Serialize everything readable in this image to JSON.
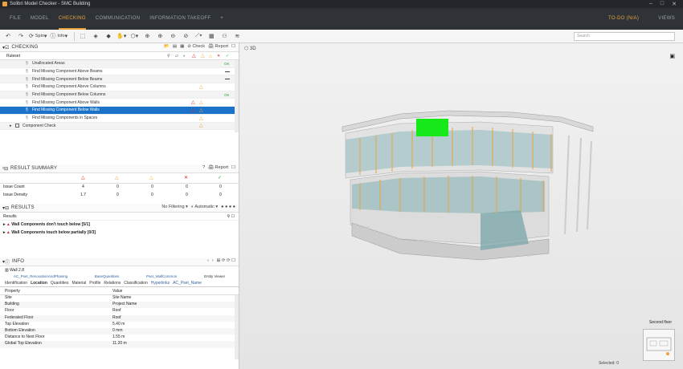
{
  "window": {
    "title": "Solibri Model Checker - SMC Building"
  },
  "menu": {
    "items": [
      "FILE",
      "MODEL",
      "CHECKING",
      "COMMUNICATION",
      "INFORMATION TAKEOFF",
      "+"
    ],
    "active_index": 2,
    "todo": "TO-DO (N/A)",
    "views": "VIEWS"
  },
  "toolbar": {
    "spin": "Spin",
    "info": "Info",
    "search_placeholder": "Search"
  },
  "checking": {
    "title": "CHECKING",
    "check": "Check",
    "report": "Report",
    "ruleset_header": "Ruleset",
    "rows": [
      {
        "label": "Unallocated Areas",
        "status": "OK"
      },
      {
        "label": "Find Missing Component Above Beams",
        "status": "dash"
      },
      {
        "label": "Find Missing Component Below Beams",
        "status": "dash"
      },
      {
        "label": "Find Missing Component Above Columns",
        "status": "warn"
      },
      {
        "label": "Find Missing Component Below Columns",
        "status": "OK"
      },
      {
        "label": "Find Missing Component Above Walls",
        "status": "err-warn"
      },
      {
        "label": "Find Missing Component Below Walls",
        "status": "err-warn",
        "selected": true
      },
      {
        "label": "Find Missing Components in Spaces",
        "status": "warn"
      },
      {
        "label": "Component Check",
        "status": "warn"
      }
    ]
  },
  "summary": {
    "title": "RESULT SUMMARY",
    "report": "Report",
    "rows": [
      {
        "label": "Issue Count",
        "values": [
          "4",
          "0",
          "0",
          "0",
          "0"
        ]
      },
      {
        "label": "Issue Density",
        "values": [
          "1.7",
          "0",
          "0",
          "0",
          "0"
        ]
      }
    ]
  },
  "results": {
    "title": "RESULTS",
    "filter": "No Filtering",
    "sort": "Automatic",
    "header": "Results",
    "items": [
      "Wall Components don't touch below [5/1]",
      "Wall Components touch below partially [0/3]"
    ]
  },
  "info": {
    "title": "INFO",
    "object": "Wall 2.8",
    "tabs_row1": [
      "AC_Pset_RenovationAndPhasing",
      "BaseQuantities",
      "Pset_WallCommon",
      "Entity Viewer"
    ],
    "tabs_row2": [
      "Identification",
      "Location",
      "Quantities",
      "Material",
      "Profile",
      "Relations",
      "Classification",
      "Hyperlinks",
      "AC_Pset_Name"
    ],
    "col_property": "Property",
    "col_value": "Value",
    "rows": [
      [
        "Site",
        "Site Name"
      ],
      [
        "Building",
        "Project Name"
      ],
      [
        "Floor",
        "Roof"
      ],
      [
        "Federated Floor",
        "Roof"
      ],
      [
        "Top Elevation",
        "5.40 m"
      ],
      [
        "Bottom Elevation",
        "0 mm"
      ],
      [
        "Distance to Next Floor",
        "1.55 m"
      ],
      [
        "Global Top Elevation",
        "11.20 m"
      ]
    ]
  },
  "view3d": {
    "title": "3D",
    "selected": "Selected: 0",
    "floor": "Second floor"
  },
  "colors": {
    "accent": "#e8a33d",
    "selection": "#1a73c8",
    "ok": "#2aa838",
    "error": "#d22222",
    "warning": "#e8a33d"
  }
}
